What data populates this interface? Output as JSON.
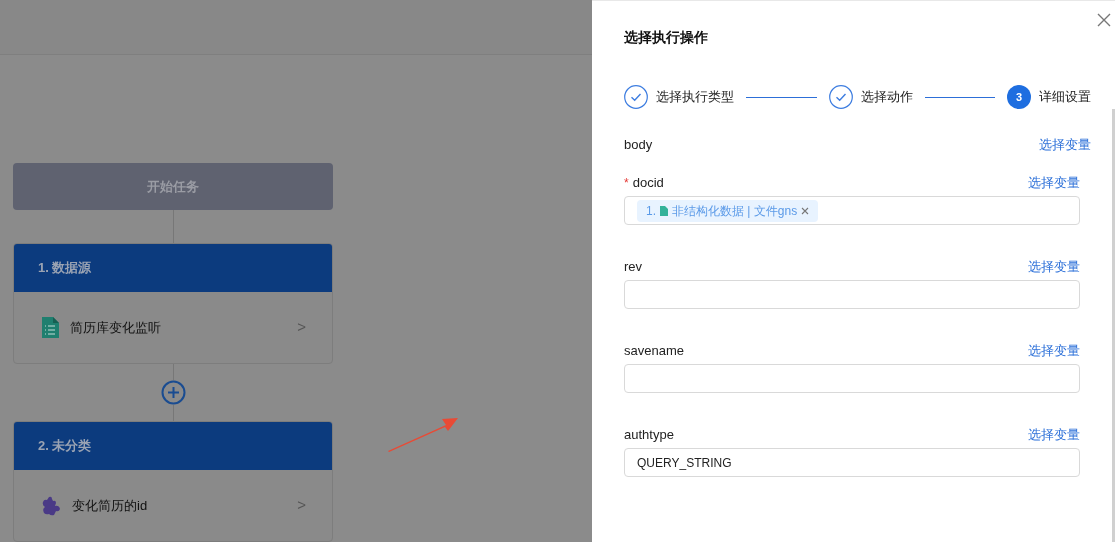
{
  "canvas": {
    "start_node": {
      "label": "开始任务"
    },
    "nodes": [
      {
        "title": "1. 数据源",
        "kind": "sheet",
        "label": "简历库变化监听",
        "chevron": ">"
      },
      {
        "title": "2. 未分类",
        "kind": "puzzle",
        "label": "变化简历的id",
        "chevron": ">"
      }
    ]
  },
  "drawer": {
    "title": "选择执行操作",
    "steps": [
      {
        "label": "选择执行类型",
        "completed": true
      },
      {
        "label": "选择动作",
        "completed": true
      },
      {
        "label": "详细设置",
        "completed": false,
        "number": "3"
      }
    ],
    "fields": [
      {
        "kind": "heading",
        "label": "body",
        "link": "选择变量"
      },
      {
        "kind": "tags",
        "label": "docid",
        "required_mark": "*",
        "link": "选择变量",
        "tags": [
          {
            "index": "1.",
            "text": "非结构化数据 | 文件gns"
          }
        ]
      },
      {
        "kind": "input",
        "label": "rev",
        "link": "选择变量"
      },
      {
        "kind": "input",
        "label": "savename",
        "link": "选择变量"
      },
      {
        "kind": "input",
        "label": "authtype",
        "link": "选择变量",
        "value": "QUERY_STRING"
      }
    ]
  }
}
